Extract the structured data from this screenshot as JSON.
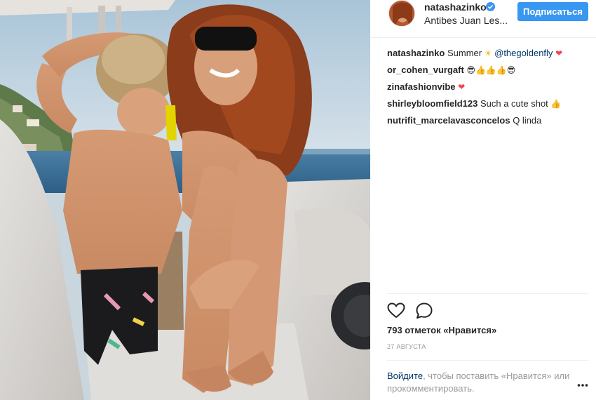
{
  "header": {
    "username": "natashazinko",
    "location": "Antibes Juan Les...",
    "follow_label": "Подписаться"
  },
  "comments": [
    {
      "user": "natashazinko",
      "text": "Summer",
      "emoji_after": "☀",
      "mention": "@thegoldenfly",
      "emoji_end": "❤"
    },
    {
      "user": "or_cohen_vurgaft",
      "emoji": "😎👍👍👍😎"
    },
    {
      "user": "zinafashionvibe",
      "emoji": "❤"
    },
    {
      "user": "shirleybloomfield123",
      "text": "Such a cute shot",
      "emoji": "👍"
    },
    {
      "user": "nutrifit_marcelavasconcelos",
      "text": "Q linda"
    }
  ],
  "actions": {
    "like_icon": "heart-icon",
    "comment_icon": "comment-icon"
  },
  "likes_text": "793 отметок «Нравится»",
  "date_text": "27 АВГУСТА",
  "login": {
    "link_text": "Войдите",
    "rest_text": ", чтобы поставить «Нравится» или прокомментировать."
  },
  "colors": {
    "accent": "#3897f0",
    "link": "#003569",
    "heart": "#ed4956",
    "muted": "#999999"
  }
}
